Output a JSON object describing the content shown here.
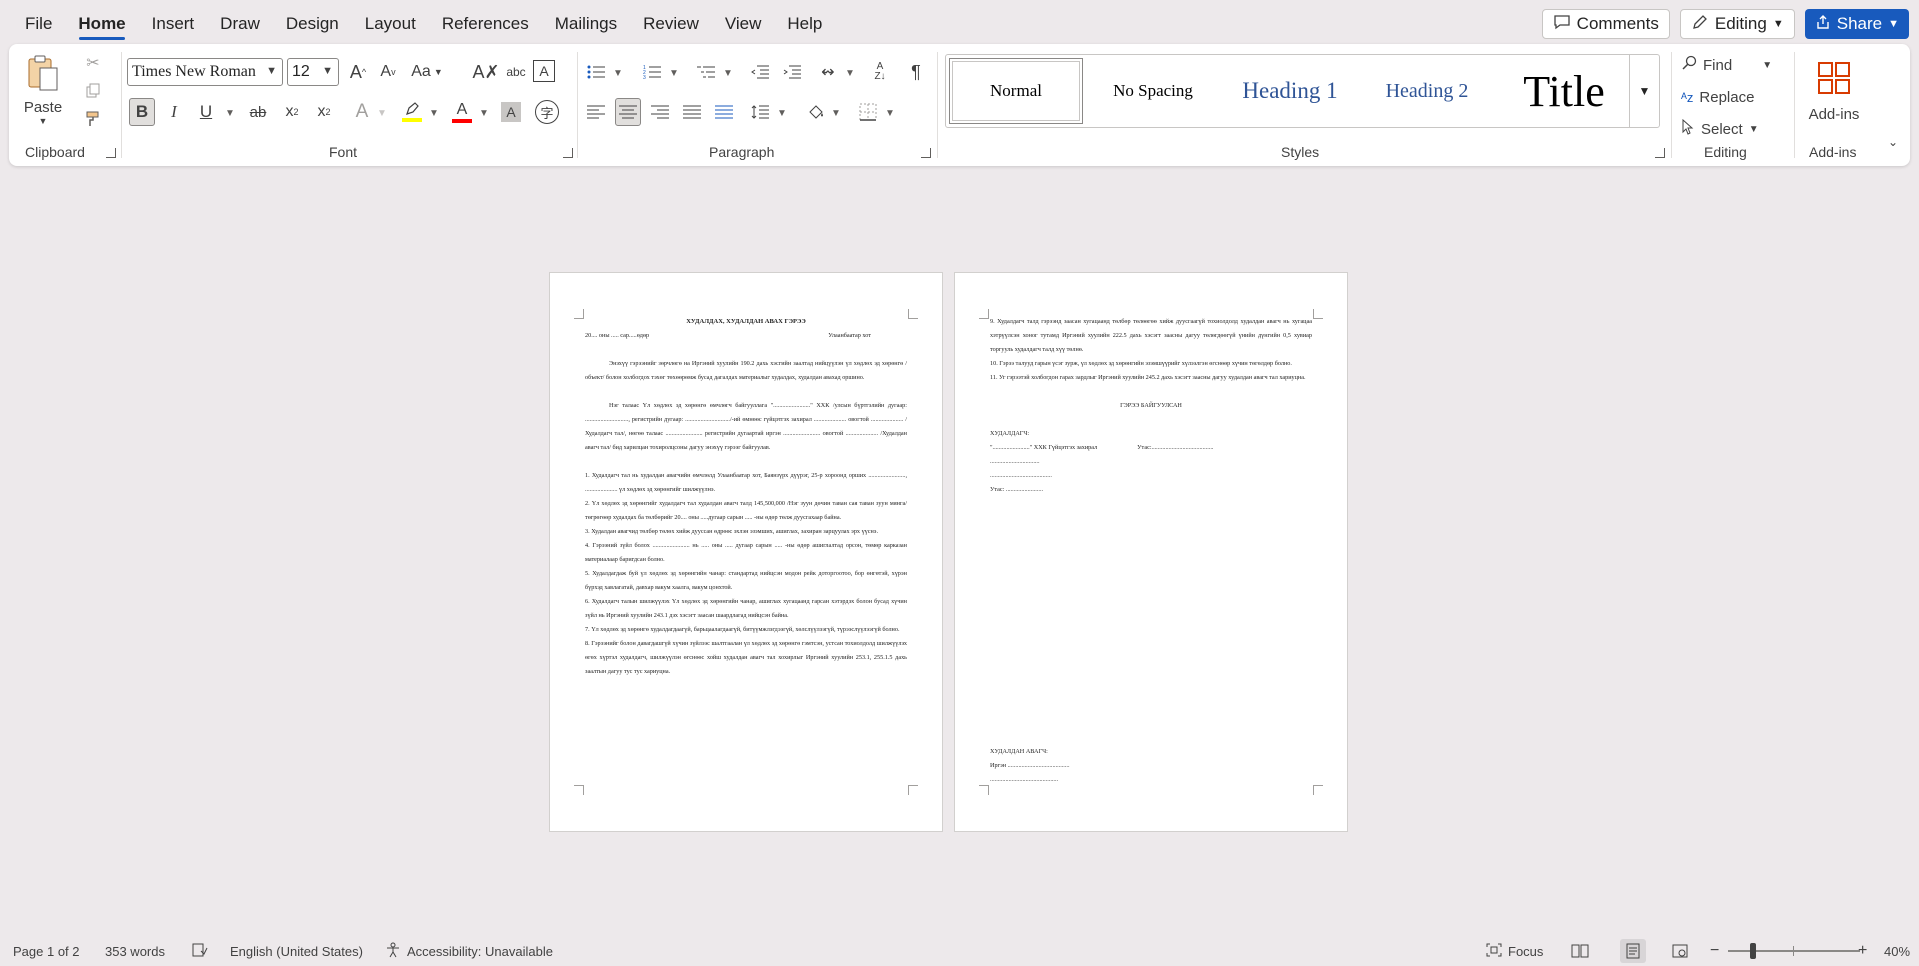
{
  "menu": {
    "items": [
      "File",
      "Home",
      "Insert",
      "Draw",
      "Design",
      "Layout",
      "References",
      "Mailings",
      "Review",
      "View",
      "Help"
    ],
    "active": "Home",
    "comments_label": "Comments",
    "editing_label": "Editing",
    "share_label": "Share"
  },
  "ribbon": {
    "clipboard": {
      "paste_label": "Paste",
      "group_label": "Clipboard"
    },
    "font": {
      "name": "Times New Roman",
      "size": "12",
      "group_label": "Font",
      "highlight_color": "#ffff00",
      "font_color": "#ff0000"
    },
    "paragraph": {
      "group_label": "Paragraph"
    },
    "styles": {
      "group_label": "Styles",
      "items": [
        "Normal",
        "No Spacing",
        "Heading 1",
        "Heading 2",
        "Title"
      ],
      "selected": "Normal"
    },
    "editing": {
      "find_label": "Find",
      "replace_label": "Replace",
      "select_label": "Select",
      "group_label": "Editing"
    },
    "addins": {
      "label": "Add-ins",
      "group_label": "Add-ins"
    }
  },
  "document": {
    "page1": {
      "title": "ХУДАЛДАХ, ХУДАЛДАН АВАХ ГЭРЭЭ",
      "date_line": "20.... оны ..... сар.....өдөр",
      "city": "Улаанбаатар хот",
      "intro": "Энэхүү гэрээнийг зөрчлөгө на Иргэний хуулийн 190.2 дахь хэсгийн заалтад нийцүүлэн үл хөдлөх эд хөрөнгө /объект/ болон холбогдох тэхөг төхөөрөмж бусад дагалдах материалыг худалдах, худалдан авахад оршино.",
      "parties": "Нэг талаас Үл хөдлөх эд хөрөнгө өмчлөгч байгууллага \"........................\" ХХК /улсын бүртгэлийн дугаар: ............................, регистрийн дугаар: ............................./-ий өмнөөс гүйцэтгэх захирал ..................... овогтой ..................... /Худалдагч тал/, нөгөө талаас ........................ регистрийн дугаартай иргэн ........................ овогтой ..................... /Худалдан авагч тал/ бид харилцан тохиролцсоны дагуу энэхүү гэрээг байгуулав.",
      "clauses": [
        "1. Худалдагч тал нь худалдан авагчийн өмчлөлд Улаанбаатар хот, Баянзүрх дүүрэг, 25-р хороонд орших ........................, ..................... үл хөдлөх эд хөрөнгийг шилжүүлнэ.",
        "2. Үл хөдлөх эд хөрөнгийг худалдагч тал худалдан авагч талд 145,500,000 /Нэг зуун дөчин таван сая таван зуун мянга/ төгрөгөөр худалдах ба төлбөрийг 20.... оны .....дугаар сарын ..... -ны өдөр төлж дуусгахаар байна.",
        "3. Худалдан авагчид төлбөр төлөх хийж дууссан өдрөөс эхлэн эзэмших, ашиглах, захиран зарцуулах эрх үүснэ.",
        "4. Гэрээний зүйл болох ........................ нь ..... оны ..... дугаар сарын ..... -ны өдөр ашиглалтад орсон, төмөр карказан материалаар баригдсан болно.",
        "5. Худалдагдаж буй үл хөдлөх эд хөрөнгийн чанар: стандартад нийцсэн модон рейк доторгоотоо, бор өнгөтэй, хүрэн бүрхэд хавлагатай, давхар вакум хаалга, вакум цонхтой.",
        "6. Худалдагч талын шилжүүлэх Үл хөдлөх эд хөрөнгийн чанар, ашиглах хугацаанд гарсан хэтэрдэх болон бусад хүчин зүйл нь Иргэний хуулийн 243.1 дэх хэсэгт заасан шаардлагад нийцсэн байна.",
        "7. Үл хөдлөх эд хөрөнгө худалдагдаагүй, барьцаалагдаагүй, битүүмжлэгдээгүй, хөлслүүлээгүй, түрээслүүлээгүй болно.",
        "8. Гэрээнийг болон давагдашгүй хүчин зүйлээс шалтгаалан үл хөдлөх эд хөрөнгө гэмтсэн, устсан тохиолдолд шилжүүлэх өгөх хүртэл худалдагч, шилжүүлэн өгснөөс хойш худалдан авагч тал хохирлыг Иргэний хуулийн 253.1, 255.1.5 дахь заалтын дагуу тус тус хариуцна."
      ]
    },
    "page2": {
      "clauses": [
        "9. Худалдагч талд гэрээнд заасан хугацаанд төлбөр төлөөгөө хийж дуусгаагүй тохиолдолд худалдан авагч нь хугацаа хэтрүүлсэн хоног тутамд Иргэний хуулийн 222.5 дахь хэсэгт заасны дагуу төлөгдөөгүй үнийн дүнгийн 0,5 хувиар торгууль худалдагч талд хүү төлнө.",
        "10. Гэрээ талууд гарын үсэг зурж, үл хөдлөх эд хөрөнгийн эзэмшүүрийг хүлээлгэн өгснөөр хүчин төгөлдөр болно.",
        "11. Уг гэрээтэй холбогдон гарах зардлыг Иргэний хуулийн 245.2 дахь хэсэгт заасны дагуу худалдан авагч тал хариуцна."
      ],
      "signers_title": "ГЭРЭЭ БАЙГУУЛСАН",
      "seller_title": "ХУДАЛДАГЧ:",
      "seller_company": "\"........................\" ХХК  Гүйцэтгэх захирал",
      "seller_phone_right": "Утас:........................................",
      "seller_line1": "................................",
      "seller_line2": "........................................",
      "seller_phone": "Утас: ........................",
      "buyer_title": "ХУДАЛДАН АВАГЧ:",
      "buyer_citizen": "Иргэн ........................................",
      "buyer_line": "............................................"
    }
  },
  "status": {
    "page": "Page 1 of 2",
    "words": "353 words",
    "language": "English (United States)",
    "accessibility": "Accessibility: Unavailable",
    "focus": "Focus",
    "zoom": "40%"
  }
}
